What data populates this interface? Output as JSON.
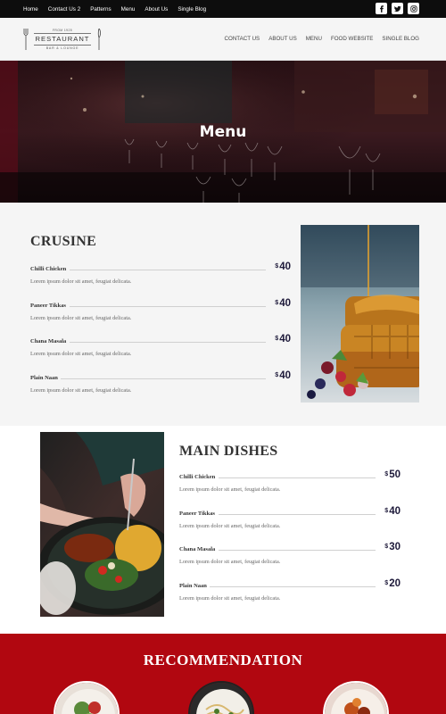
{
  "topbar": {
    "nav": [
      "Home",
      "Contact Us 2",
      "Patterns",
      "Menu",
      "About Us",
      "Single Blog"
    ],
    "socials": [
      {
        "icon": "facebook-icon"
      },
      {
        "icon": "twitter-icon"
      },
      {
        "icon": "instagram-icon"
      }
    ]
  },
  "header": {
    "logo": {
      "since": "FROM 1925",
      "name": "RESTAURANT",
      "sub": "BAR & LOUNGE"
    },
    "nav": [
      "CONTACT US",
      "ABOUT US",
      "MENU",
      "FOOD WEBSITE",
      "SINGLE BLOG"
    ]
  },
  "hero": {
    "title": "Menu"
  },
  "section1": {
    "title": "CRUSINE",
    "items": [
      {
        "name": "Chilli Chicken",
        "currency": "$",
        "price": "40",
        "desc": "Lorem ipsum dolor sit amet, feugiat delicata."
      },
      {
        "name": "Paneer Tikkas",
        "currency": "$",
        "price": "40",
        "desc": "Lorem ipsum dolor sit amet, feugiat delicata."
      },
      {
        "name": "Chana Masala",
        "currency": "$",
        "price": "40",
        "desc": "Lorem ipsum dolor sit amet, feugiat delicata."
      },
      {
        "name": "Plain Naan",
        "currency": "$",
        "price": "40",
        "desc": "Lorem ipsum dolor sit amet, feugiat delicata."
      }
    ]
  },
  "section2": {
    "title": "MAIN DISHES",
    "items": [
      {
        "name": "Chilli Chicken",
        "currency": "$",
        "price": "50",
        "desc": "Lorem ipsum dolor sit amet, feugiat delicata."
      },
      {
        "name": "Paneer Tikkas",
        "currency": "$",
        "price": "40",
        "desc": "Lorem ipsum dolor sit amet, feugiat delicata."
      },
      {
        "name": "Chana Masala",
        "currency": "$",
        "price": "30",
        "desc": "Lorem ipsum dolor sit amet, feugiat delicata."
      },
      {
        "name": "Plain Naan",
        "currency": "$",
        "price": "20",
        "desc": "Lorem ipsum dolor sit amet, feugiat delicata."
      }
    ]
  },
  "recommendation": {
    "title": "RECOMMENDATION"
  },
  "colors": {
    "topbar": "#0d0d0d",
    "header": "#f5f5f5",
    "accent_red": "#b10710",
    "price": "#1e1a3a"
  }
}
